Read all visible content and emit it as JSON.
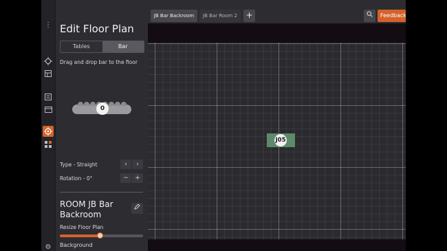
{
  "panel": {
    "title": "Edit Floor Plan",
    "tabs": [
      {
        "label": "Tables"
      },
      {
        "label": "Bar"
      }
    ],
    "hint": "Drag and drop bar to the floor",
    "bar_preview_number": "0",
    "type_label": "Type - Straight",
    "rotation_label": "Rotation - 0°",
    "room_name": "ROOM JB Bar Backroom",
    "resize_label": "Resize Floor Plan",
    "resize_value": 0.48,
    "background_label": "Background"
  },
  "topbar": {
    "tabs": [
      {
        "label": "JB Bar Backroom"
      },
      {
        "label": "JB Bar Room 2"
      }
    ],
    "add_label": "+",
    "feedback_label": "Feedback"
  },
  "canvas": {
    "tables": [
      {
        "label": "J05",
        "color": "#5c8a6a"
      }
    ]
  },
  "colors": {
    "accent": "#d5622b",
    "panel_bg": "#2c2c31"
  }
}
